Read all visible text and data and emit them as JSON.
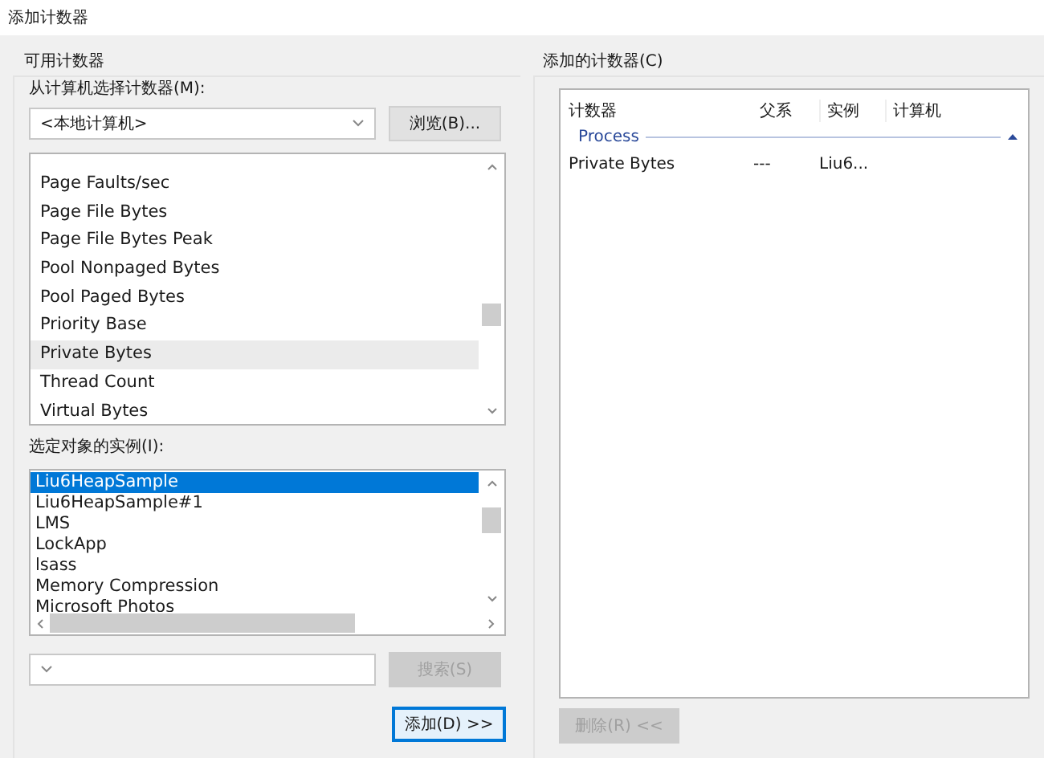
{
  "window": {
    "title": "添加计数器"
  },
  "available": {
    "group_label": "可用计数器",
    "machine_label": "从计算机选择计数器(M):",
    "machine_value": "<本地计算机>",
    "browse_button": "浏览(B)...",
    "counters": [
      {
        "label": "Page Faults/sec",
        "selected": false
      },
      {
        "label": "Page File Bytes",
        "selected": false
      },
      {
        "label": "Page File Bytes Peak",
        "selected": false
      },
      {
        "label": "Pool Nonpaged Bytes",
        "selected": false
      },
      {
        "label": "Pool Paged Bytes",
        "selected": false
      },
      {
        "label": "Priority Base",
        "selected": false
      },
      {
        "label": "Private Bytes",
        "selected": true
      },
      {
        "label": "Thread Count",
        "selected": false
      },
      {
        "label": "Virtual Bytes",
        "selected": false
      }
    ],
    "instances_label": "选定对象的实例(I):",
    "instances": [
      {
        "label": "Liu6HeapSample",
        "selected": true
      },
      {
        "label": "Liu6HeapSample#1",
        "selected": false
      },
      {
        "label": "LMS",
        "selected": false
      },
      {
        "label": "LockApp",
        "selected": false
      },
      {
        "label": "lsass",
        "selected": false
      },
      {
        "label": "Memory Compression",
        "selected": false
      },
      {
        "label": "Microsoft Photos",
        "selected": false
      }
    ],
    "search_button": {
      "label": "搜索(S)",
      "disabled": true
    },
    "add_button": "添加(D) >>"
  },
  "added": {
    "group_label": "添加的计数器(C)",
    "columns": [
      "计数器",
      "父系",
      "实例",
      "计算机"
    ],
    "groups": [
      {
        "name": "Process",
        "expanded": true,
        "rows": [
          {
            "cells": [
              "Private Bytes",
              "---",
              "Liu6..."
            ]
          }
        ]
      }
    ],
    "remove_button": {
      "label": "删除(R) <<",
      "disabled": true
    }
  }
}
